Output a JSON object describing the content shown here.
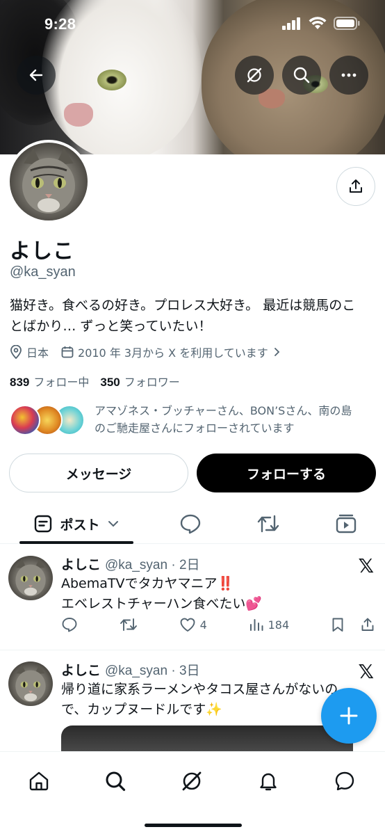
{
  "status_bar": {
    "time": "9:28"
  },
  "profile": {
    "name": "よしこ",
    "handle": "@ka_syan",
    "bio_line1": "猫好き。食べるの好き。プロレス大好き。 最近は競馬のこ",
    "bio_line2": "とばかり… ずっと笑っていたい！",
    "location": "日本",
    "joined": "2010 年 3月から X を利用しています",
    "following_count": "839",
    "following_label": "フォロー中",
    "followers_count": "350",
    "followers_label": "フォロワー",
    "followed_by_line1": "アマゾネス・ブッチャーさん、BON’Sさん、南の島",
    "followed_by_line2": "のご馳走屋さんにフォローされています"
  },
  "buttons": {
    "message": "メッセージ",
    "follow": "フォローする"
  },
  "tabs": {
    "posts": "ポスト"
  },
  "posts": [
    {
      "name": "よしこ",
      "meta": "@ka_syan · 2日",
      "line1": "AbemaTVでタカヤマニア‼️",
      "line2": "エベレストチャーハン食べたい💕",
      "likes": "4",
      "views": "184",
      "x_mark": "𝕏"
    },
    {
      "name": "よしこ",
      "meta": "@ka_syan · 3日",
      "line1": "帰り道に家系ラーメンやタコス屋さんがないの",
      "line2": "で、カップヌードルです✨",
      "x_mark": "𝕏"
    }
  ],
  "colors": {
    "accent": "#1d9bf0",
    "text_primary": "#0f1419",
    "text_secondary": "#536471",
    "follow_button_bg": "#000000"
  },
  "icons": [
    "back-arrow-icon",
    "grok-icon",
    "search-icon",
    "more-icon",
    "share-icon",
    "location-icon",
    "calendar-icon",
    "chevron-right-icon",
    "posts-icon",
    "chevron-down-icon",
    "replies-icon",
    "reposts-icon",
    "media-icon",
    "reply-icon",
    "retweet-icon",
    "like-icon",
    "views-icon",
    "bookmark-icon",
    "compose-icon",
    "home-icon",
    "notifications-icon",
    "messages-icon"
  ]
}
